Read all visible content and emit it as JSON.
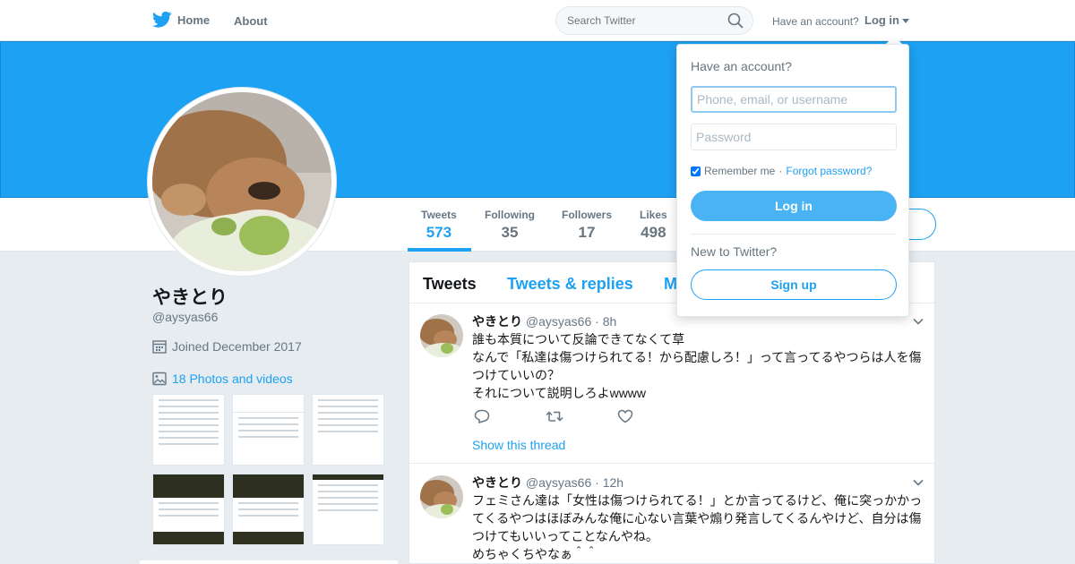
{
  "nav": {
    "home_label": "Home",
    "about_label": "About",
    "search_placeholder": "Search Twitter",
    "have_account": "Have an account?",
    "login_label": "Log in"
  },
  "profile": {
    "name": "やきとり",
    "handle": "@aysyas66",
    "joined": "Joined December 2017",
    "photos_link": "18 Photos and videos"
  },
  "stats": [
    {
      "label": "Tweets",
      "value": "573"
    },
    {
      "label": "Following",
      "value": "35"
    },
    {
      "label": "Followers",
      "value": "17"
    },
    {
      "label": "Likes",
      "value": "498"
    }
  ],
  "timeline": {
    "tabs": [
      "Tweets",
      "Tweets & replies",
      "M"
    ],
    "tweets": [
      {
        "name": "やきとり",
        "handle": "@aysyas66",
        "time": "· 8h",
        "lines": [
          "誰も本質について反論できてなくて草",
          "なんで「私達は傷つけられてる！から配慮しろ！」って言ってるやつらは人を傷",
          "つけていいの？",
          "それについて説明しろよwwww"
        ],
        "thread_link": "Show this thread"
      },
      {
        "name": "やきとり",
        "handle": "@aysyas66",
        "time": "· 12h",
        "lines": [
          "フェミさん達は「女性は傷つけられてる！」とか言ってるけど、俺に突っかかっ",
          "てくるやつはほぼみんな俺に心ない言葉や煽り発言してくるんやけど、自分は傷",
          "つけてもいいってことなんやね。",
          "めちゃくちやなぁ＾＾"
        ]
      }
    ]
  },
  "login_dropdown": {
    "title": "Have an account?",
    "username_placeholder": "Phone, email, or username",
    "password_placeholder": "Password",
    "remember_me": "Remember me",
    "separator": "·",
    "forgot_password": "Forgot password?",
    "login_button": "Log in",
    "new_to_twitter": "New to Twitter?",
    "signup_button": "Sign up"
  },
  "colors": {
    "brand": "#1da1f2",
    "banner": "#1da1f2",
    "text_muted": "#657786"
  },
  "icons": {
    "logo": "twitter-bird-icon",
    "search": "search-icon",
    "calendar": "calendar-icon",
    "photo": "photo-icon",
    "reply": "reply-icon",
    "retweet": "retweet-icon",
    "like": "like-icon",
    "more": "chevron-down-icon"
  }
}
